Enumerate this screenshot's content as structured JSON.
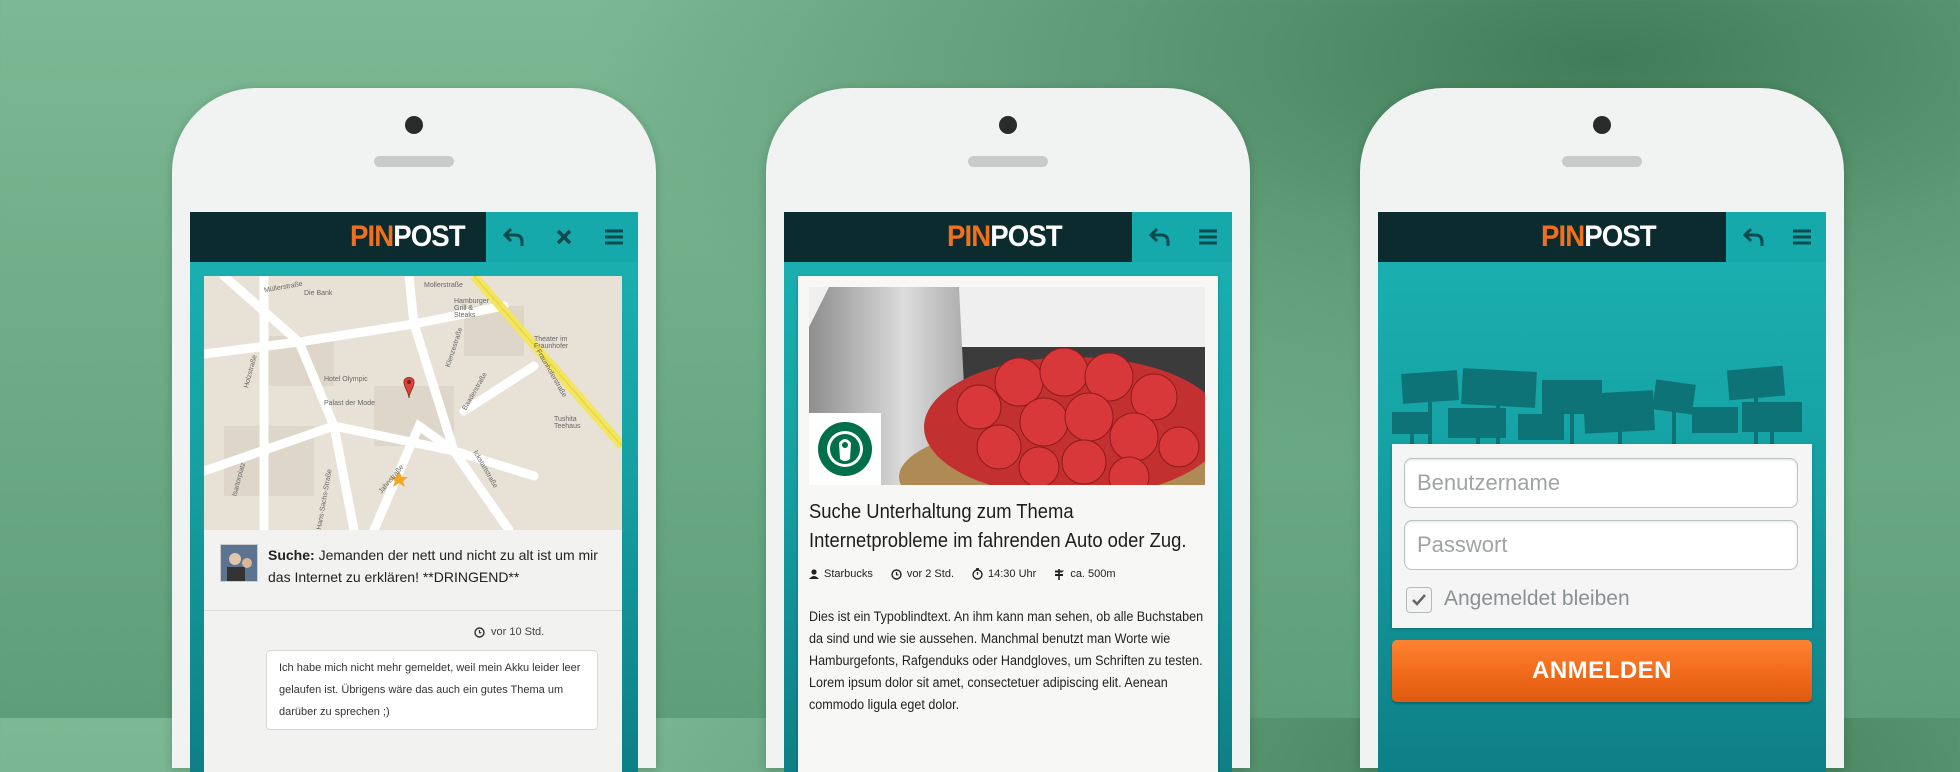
{
  "brand": {
    "pin": "PIN",
    "post": "POST"
  },
  "colors": {
    "accent_orange": "#f0701e",
    "teal": "#16a3a5",
    "dark_header": "#0b2b2e"
  },
  "phone1": {
    "map_labels": {
      "mullerstrasse": "Müllerstraße",
      "mollerstrasse": "Mollerstraße",
      "frauenhofer": "Fraunhoferstraße",
      "klenzestrasse": "Klenzestraße",
      "isartorplatz": "Isartorplatz",
      "holzstrasse": "Holzstraße",
      "hans_sachs": "Hans-Sachs-Straße",
      "jahnstrasse": "Jahnstraße",
      "baaderstrasse": "Baaderstraße",
      "ickstattstrasse": "Ickstattstraße",
      "bank": "Die Bank",
      "hotel": "Hotel Olympic",
      "palast": "Palast der Mode",
      "theater": "Theater im Fraunhofer",
      "burger": "Hamburger Grill & Steaks",
      "tushita": "Tushita Teehaus"
    },
    "post": {
      "label": "Suche:",
      "text": " Jemanden der nett und nicht zu alt ist um mir das Internet zu erklären! **DRINGEND**"
    },
    "reply": {
      "time": "vor 10 Std.",
      "text": "Ich habe mich nicht mehr gemeldet, weil mein Akku leider leer gelaufen ist. Übrigens wäre das auch ein gutes Thema um darüber zu sprechen ;)"
    }
  },
  "phone2": {
    "title": "Suche Unterhaltung zum Thema Internetprobleme im fahrenden Auto oder Zug.",
    "meta": {
      "user": "Starbucks",
      "time": "vor 2 Std.",
      "clock": "14:30 Uhr",
      "distance": "ca. 500m"
    },
    "body": "Dies ist ein Typoblindtext. An ihm kann man sehen, ob alle Buchstaben da sind und wie sie aussehen. Manchmal benutzt man Worte wie Hamburgefonts, Rafgenduks oder Handgloves, um Schriften zu testen. Lorem ipsum dolor sit amet, consectetuer adipiscing elit. Aenean commodo ligula eget dolor."
  },
  "phone3": {
    "username_placeholder": "Benutzername",
    "password_placeholder": "Passwort",
    "remember_label": "Angemeldet bleiben",
    "remember_checked": true,
    "login_label": "ANMELDEN"
  }
}
